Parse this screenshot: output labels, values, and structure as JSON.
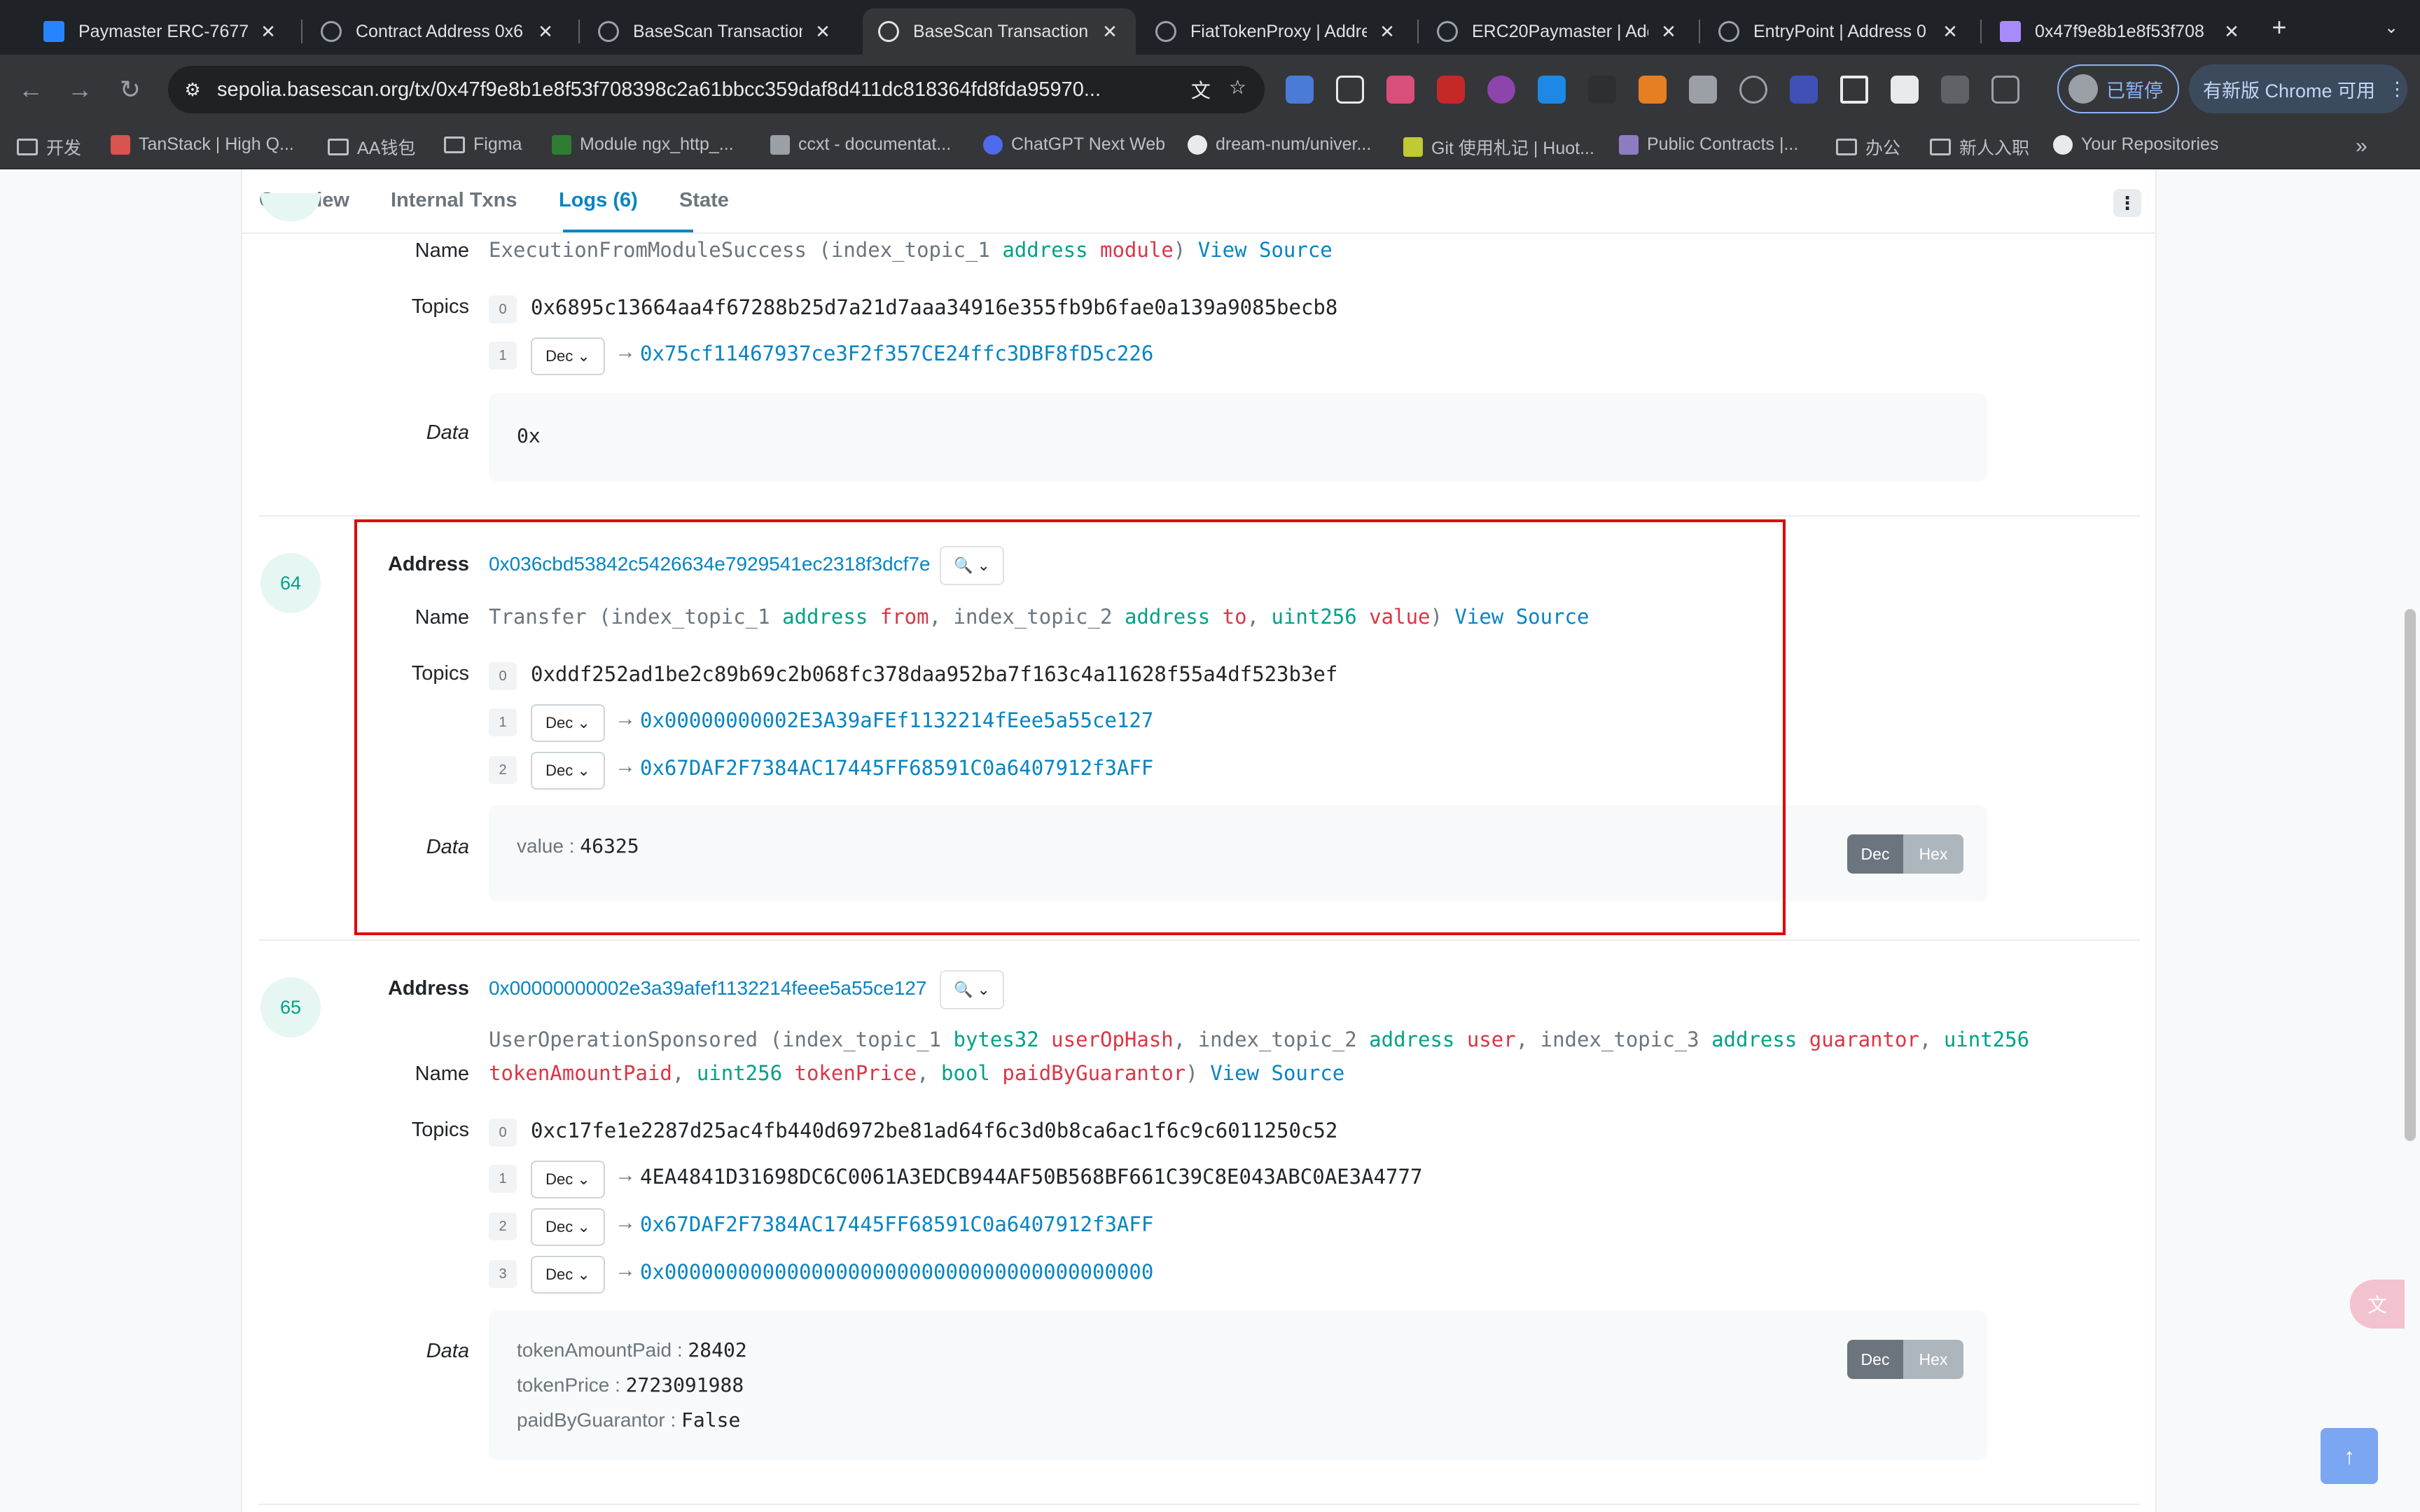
{
  "browser": {
    "tabs": [
      {
        "title": "Paymaster ERC-7677 - ",
        "favicon_color": "#2684ff"
      },
      {
        "title": "Contract Address 0x6",
        "favicon_color": "#9aa0a6"
      },
      {
        "title": "BaseScan Transaction",
        "favicon_color": "#9aa0a6"
      },
      {
        "title": "BaseScan Transaction",
        "favicon_color": "#9aa0a6"
      },
      {
        "title": "FiatTokenProxy | Addre",
        "favicon_color": "#9aa0a6"
      },
      {
        "title": "ERC20Paymaster | Add",
        "favicon_color": "#9aa0a6"
      },
      {
        "title": "EntryPoint | Address 0",
        "favicon_color": "#9aa0a6"
      },
      {
        "title": "0x47f9e8b1e8f53f708",
        "favicon_color": "#a78bfa"
      }
    ],
    "active_tab_index": 3,
    "new_tab": "+",
    "tab_menu": "⌄",
    "url": "sepolia.basescan.org/tx/0x47f9e8b1e8f53f708398c2a61bbcc359daf8d411dc818364fd8fda95970...",
    "pause_label": "已暂停",
    "update_label": "有新版 Chrome 可用",
    "bookmarks": [
      {
        "label": "开发",
        "icon": "folder"
      },
      {
        "label": "TanStack | High Q...",
        "icon": "tanstack",
        "color": "#d9534f"
      },
      {
        "label": "AA钱包",
        "icon": "folder"
      },
      {
        "label": "Figma",
        "icon": "folder"
      },
      {
        "label": "Module ngx_http_...",
        "icon": "nginx",
        "color": "#2e7d32"
      },
      {
        "label": "ccxt - documentat...",
        "icon": "ccxt",
        "color": "#9aa0a6"
      },
      {
        "label": "ChatGPT Next Web",
        "icon": "chatgpt",
        "color": "#4f6bed"
      },
      {
        "label": "dream-num/univer...",
        "icon": "github",
        "color": "#e8eaed"
      },
      {
        "label": "Git 使用札记 | Huot...",
        "icon": "k",
        "color": "#c0ca33"
      },
      {
        "label": "Public Contracts |...",
        "icon": "public",
        "color": "#8e7cc3"
      },
      {
        "label": "办公",
        "icon": "folder"
      },
      {
        "label": "新人入职",
        "icon": "folder"
      },
      {
        "label": "Your Repositories",
        "icon": "github",
        "color": "#e8eaed"
      }
    ]
  },
  "page": {
    "tabs": [
      {
        "label": "Overview"
      },
      {
        "label": "Internal Txns"
      },
      {
        "label": "Logs (6)"
      },
      {
        "label": "State"
      }
    ],
    "active_tab": "Logs (6)",
    "labels": {
      "address": "Address",
      "name": "Name",
      "topics": "Topics",
      "data": "Data",
      "dec": "Dec",
      "hex": "Hex",
      "view_source": "View Source"
    },
    "log63": {
      "signature": {
        "fn": "ExecutionFromModuleSuccess",
        "params": [
          {
            "idx": "index_topic_1",
            "type": "address",
            "name": "module"
          }
        ]
      },
      "topics": [
        {
          "index": "0",
          "value": "0x6895c13664aa4f67288b25d7a21d7aaa34916e355fb9b6fae0a139a9085becb8"
        },
        {
          "index": "1",
          "format": "Dec",
          "value": "0x75cf11467937ce3F2f357CE24ffc3DBF8fD5c226",
          "link": true
        }
      ],
      "data": "0x"
    },
    "log64": {
      "index": "64",
      "address": "0x036cbd53842c5426634e7929541ec2318f3dcf7e",
      "signature": {
        "fn": "Transfer",
        "params": [
          {
            "idx": "index_topic_1",
            "type": "address",
            "name": "from"
          },
          {
            "idx": "index_topic_2",
            "type": "address",
            "name": "to"
          },
          {
            "idx": "",
            "type": "uint256",
            "name": "value"
          }
        ]
      },
      "topics": [
        {
          "index": "0",
          "value": "0xddf252ad1be2c89b69c2b068fc378daa952ba7f163c4a11628f55a4df523b3ef"
        },
        {
          "index": "1",
          "format": "Dec",
          "value": "0x00000000002E3A39aFEf1132214fEee5a55ce127",
          "link": true
        },
        {
          "index": "2",
          "format": "Dec",
          "value": "0x67DAF2F7384AC17445FF68591C0a6407912f3AFF",
          "link": true
        }
      ],
      "data": [
        {
          "key": "value",
          "value": "46325"
        }
      ]
    },
    "log65": {
      "index": "65",
      "address": "0x00000000002e3a39afef1132214feee5a55ce127",
      "signature": {
        "fn": "UserOperationSponsored",
        "params": [
          {
            "idx": "index_topic_1",
            "type": "bytes32",
            "name": "userOpHash"
          },
          {
            "idx": "index_topic_2",
            "type": "address",
            "name": "user"
          },
          {
            "idx": "index_topic_3",
            "type": "address",
            "name": "guarantor"
          },
          {
            "idx": "",
            "type": "uint256",
            "name": "tokenAmountPaid"
          },
          {
            "idx": "",
            "type": "uint256",
            "name": "tokenPrice"
          },
          {
            "idx": "",
            "type": "bool",
            "name": "paidByGuarantor"
          }
        ]
      },
      "topics": [
        {
          "index": "0",
          "value": "0xc17fe1e2287d25ac4fb440d6972be81ad64f6c3d0b8ca6ac1f6c9c6011250c52"
        },
        {
          "index": "1",
          "format": "Dec",
          "value": "4EA4841D31698DC6C0061A3EDCB944AF50B568BF661C39C8E043ABC0AE3A4777",
          "link": false
        },
        {
          "index": "2",
          "format": "Dec",
          "value": "0x67DAF2F7384AC17445FF68591C0a6407912f3AFF",
          "link": true
        },
        {
          "index": "3",
          "format": "Dec",
          "value": "0x0000000000000000000000000000000000000000",
          "link": true
        }
      ],
      "data": [
        {
          "key": "tokenAmountPaid",
          "value": "28402"
        },
        {
          "key": "tokenPrice",
          "value": "2723091988"
        },
        {
          "key": "paidByGuarantor",
          "value": "False"
        }
      ]
    }
  },
  "colors": {
    "link": "#0784c3",
    "type": "#00a186",
    "param_name": "#dc3545",
    "highlight_border": "#e00000"
  }
}
